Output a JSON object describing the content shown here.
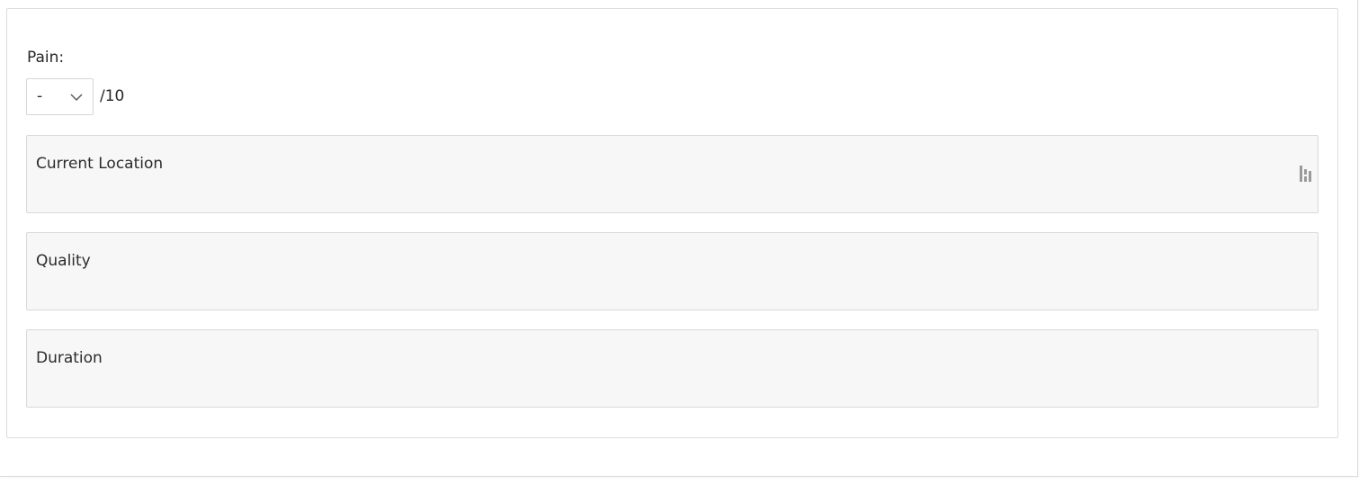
{
  "pain": {
    "label": "Pain:",
    "select": {
      "value": "-",
      "suffix": "/10"
    }
  },
  "fields": [
    {
      "placeholder": "Current Location",
      "icon": "dictation-icon"
    },
    {
      "placeholder": "Quality"
    },
    {
      "placeholder": "Duration"
    }
  ],
  "colors": {
    "field_background": "#f7f7f7",
    "field_border": "#d9d9d9",
    "text": "#262626"
  }
}
